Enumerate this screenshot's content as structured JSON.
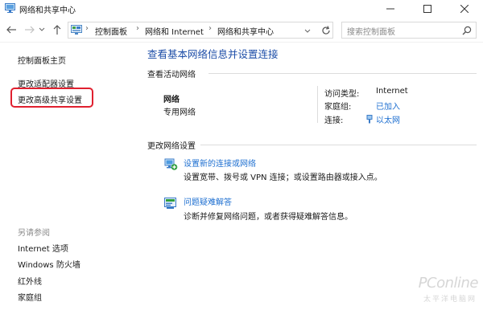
{
  "window": {
    "title": "网络和共享中心",
    "minimize_glyph": "—",
    "maximize_glyph": "☐",
    "close_glyph": "✕"
  },
  "address_bar": {
    "breadcrumbs": [
      "控制面板",
      "网络和 Internet",
      "网络和共享中心"
    ],
    "search_placeholder": "搜索控制面板"
  },
  "left_pane": {
    "links": [
      "控制面板主页",
      "更改适配器设置",
      "更改高级共享设置"
    ],
    "highlighted_link_index": 2,
    "see_also_title": "另请参阅",
    "see_also_links": [
      "Internet 选项",
      "Windows 防火墙",
      "红外线",
      "家庭组"
    ]
  },
  "main": {
    "title": "查看基本网络信息并设置连接",
    "active_networks_label": "查看活动网络",
    "network": {
      "name": "网络",
      "type": "专用网络",
      "access_type_label": "访问类型:",
      "access_type_value": "Internet",
      "homegroup_label": "家庭组:",
      "homegroup_value": "已加入",
      "connections_label": "连接:",
      "connections_value": "以太网"
    },
    "change_settings_label": "更改网络设置",
    "tasks": [
      {
        "icon": "new-connection-icon",
        "link": "设置新的连接或网络",
        "desc": "设置宽带、拨号或 VPN 连接；或设置路由器或接入点。"
      },
      {
        "icon": "troubleshoot-icon",
        "link": "问题疑难解答",
        "desc": "诊断并修复网络问题，或者获得疑难解答信息。"
      }
    ]
  },
  "watermark": {
    "brand": "PConline",
    "sub": "太平洋电脑网"
  },
  "colors": {
    "link": "#1e6fd0",
    "title_blue": "#1e4ea8",
    "highlight_red": "#e0202f"
  }
}
